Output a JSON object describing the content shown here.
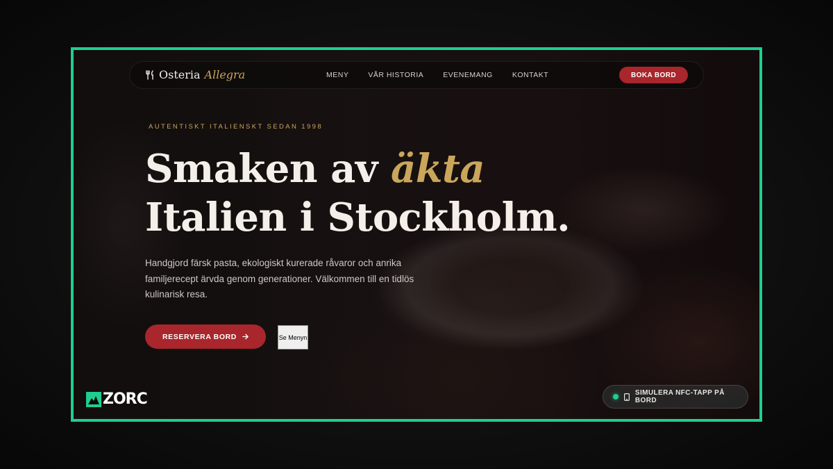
{
  "brand": {
    "name_main": "Osteria",
    "name_accent": "Allegra",
    "icon": "cutlery-icon"
  },
  "nav": {
    "links": [
      "MENY",
      "VÅR HISTORIA",
      "EVENEMANG",
      "KONTAKT"
    ],
    "cta_label": "BOKA BORD"
  },
  "hero": {
    "eyebrow": "AUTENTISKT ITALIENSKT SEDAN 1998",
    "headline_line1_main": "Smaken av",
    "headline_line1_accent": "äkta",
    "headline_line2": "Italien i Stockholm.",
    "lede": "Handgjord färsk pasta, ekologiskt kurerade råvaror och anrika familjerecept ärvda genom generationer. Välkommen till en tidlös kulinarisk resa.",
    "primary_button": "RESERVERA BORD",
    "primary_button_icon": "arrow-right-icon",
    "secondary_button": "Se Menyn"
  },
  "watermark": {
    "text": "ZORC"
  },
  "nfc": {
    "label": "SIMULERA NFC-TAPP PÅ BORD",
    "icon": "phone-icon"
  },
  "colors": {
    "frame": "#1fce8e",
    "accent_gold": "#c9a65b",
    "brand_red": "#a8262c",
    "status_green": "#1fce8e"
  }
}
